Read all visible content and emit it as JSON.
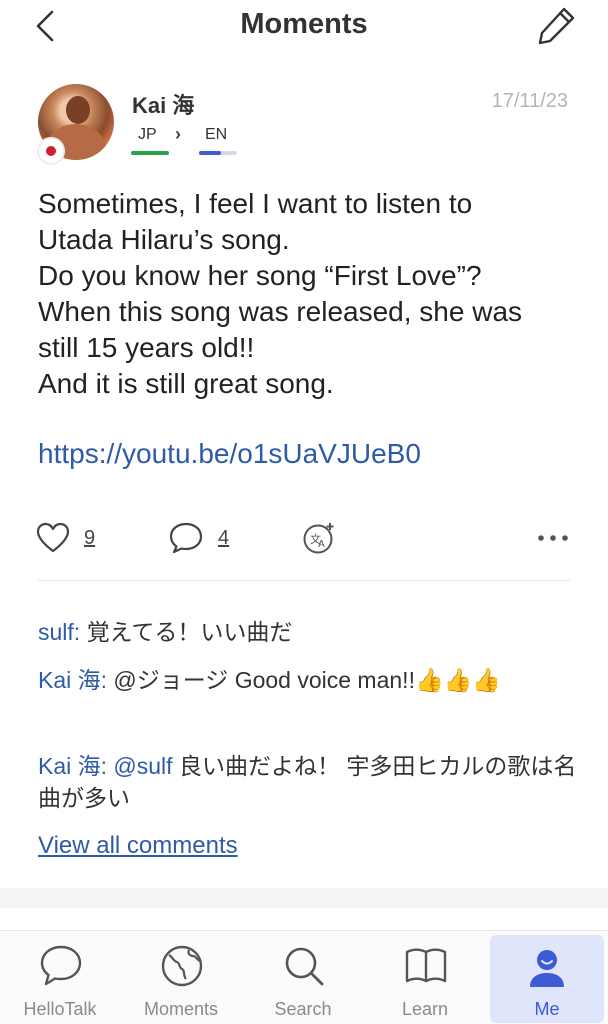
{
  "header": {
    "title": "Moments"
  },
  "post": {
    "username": "Kai 海",
    "date": "17/11/23",
    "native_lang": "JP",
    "learning_lang": "EN",
    "learning_progress": 0.55,
    "text": "Sometimes, I feel I want to listen to\nUtada Hilaru’s song.\nDo you know her song “First Love”?\nWhen this song was released, she was\nstill 15 years old!!\nAnd it is still great song.",
    "link": "https://youtu.be/o1sUaVJUeB0",
    "likes": "9",
    "comments_count": "4"
  },
  "comments": [
    {
      "author": "sulf:",
      "text": " 覚えてる！いい曲だ"
    },
    {
      "author": "Kai 海:",
      "text": " @ジョージ Good voice man!!👍👍👍"
    },
    {
      "author": "Kai 海:",
      "mention": " @sulf",
      "text": " 良い曲だよね！ 宇多田ヒカルの歌は名曲が多い"
    }
  ],
  "view_all": "View all comments",
  "tabs": {
    "hellotalk": "HelloTalk",
    "moments": "Moments",
    "search": "Search",
    "learn": "Learn",
    "me": "Me"
  },
  "colors": {
    "accent": "#3e5bd6",
    "link": "#2f5aa8",
    "native_bar": "#2aa14a"
  }
}
